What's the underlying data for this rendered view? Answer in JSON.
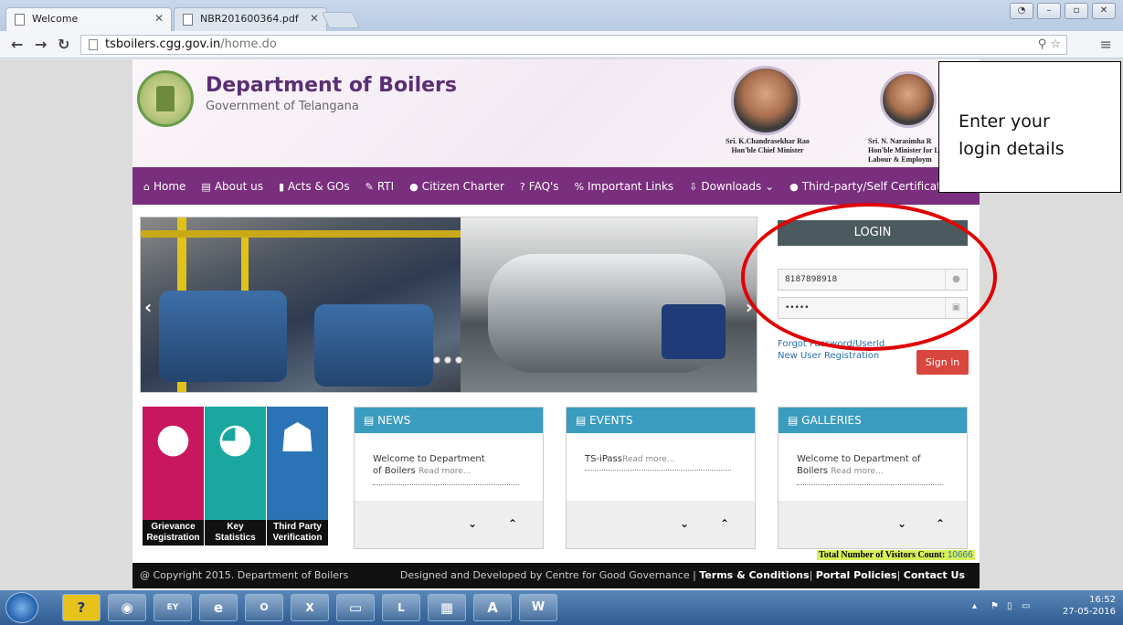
{
  "browser": {
    "tabs": [
      {
        "label": "Welcome"
      },
      {
        "label": "NBR201600364.pdf"
      }
    ],
    "url_host": "tsboilers.cgg.gov.in",
    "url_path": "/home.do"
  },
  "header": {
    "title": "Department of Boilers",
    "subtitle": "Government of Telangana",
    "dignitaries": [
      {
        "line1": "Sri. K.Chandrasekhar Rao",
        "line2": "Hon'ble Chief Minister"
      },
      {
        "line1": "Sri. N. Narasimha R",
        "line2": "Hon'ble Minister for L",
        "line3": "Labour & Employm"
      }
    ]
  },
  "nav": {
    "items": [
      {
        "icon": "⌂",
        "label": "Home"
      },
      {
        "icon": "▤",
        "label": "About us"
      },
      {
        "icon": "▮",
        "label": "Acts & GOs"
      },
      {
        "icon": "✎",
        "label": "RTI"
      },
      {
        "icon": "●",
        "label": "Citizen Charter"
      },
      {
        "icon": "?",
        "label": "FAQ's"
      },
      {
        "icon": "%",
        "label": "Important Links"
      },
      {
        "icon": "⇩",
        "label": "Downloads ⌄"
      },
      {
        "icon": "●",
        "label": "Third-party/Self Certification ⌄"
      }
    ]
  },
  "login": {
    "heading": "LOGIN",
    "username_value": "8187898918",
    "password_value": "•••••",
    "forgot_label": "Forgot Password/UserId",
    "new_user_label": "New User Registration",
    "signin_label": "Sign in"
  },
  "tiles": [
    {
      "line1": "Grievance",
      "line2": "Registration",
      "color": "#c8175f",
      "icon": "user-icon"
    },
    {
      "line1": "Key",
      "line2": "Statistics",
      "color": "#1aa7a0",
      "icon": "pie-chart-icon"
    },
    {
      "line1": "Third Party",
      "line2": "Verification",
      "color": "#2a73b7",
      "icon": "spy-icon"
    }
  ],
  "panels": {
    "news": {
      "title": "NEWS",
      "text1": "Welcome to Department",
      "text2": "of Boilers",
      "more": "Read more..."
    },
    "events": {
      "title": "EVENTS",
      "text1": "TS-iPass",
      "more": "Read more..."
    },
    "galleries": {
      "title": "GALLERIES",
      "text1": "Welcome to Department of",
      "text2": "Boilers",
      "more": "Read more..."
    }
  },
  "visitors": {
    "label": "Total Number of Visitors Count:",
    "count": "10666"
  },
  "footer": {
    "copyright": "@ Copyright 2015. Department of Boilers",
    "designed": "Designed and Developed by Centre for Good Governance |",
    "terms": "Terms & Conditions",
    "policies": "Portal Policies",
    "contact": "Contact Us"
  },
  "annotation": {
    "line1": "Enter your",
    "line2": "login details",
    "color": "#e10000"
  },
  "taskbar": {
    "time": "16:52",
    "date": "27-05-2016"
  },
  "colors": {
    "nav": "#7a2e7e",
    "panel_head": "#3a9cbf",
    "signin": "#d9453f",
    "login_head": "#4b5a5e"
  }
}
